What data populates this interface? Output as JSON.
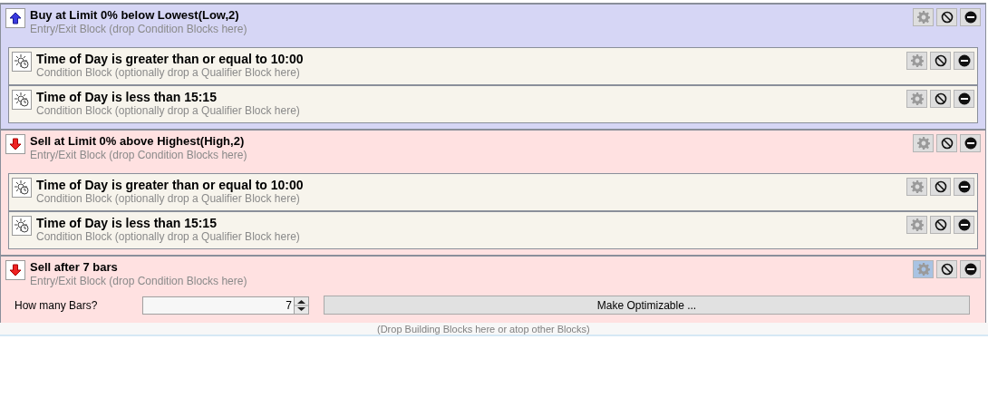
{
  "blocks": [
    {
      "kind": "buy",
      "title": "Buy at Limit 0% below Lowest(Low,2)",
      "subtitle": "Entry/Exit Block (drop Condition Blocks here)",
      "gear_highlighted": false,
      "conditions": [
        {
          "title": "Time of Day is greater than or equal to 10:00",
          "subtitle": "Condition Block (optionally drop a Qualifier Block here)"
        },
        {
          "title": "Time of Day is less than 15:15",
          "subtitle": "Condition Block (optionally drop a Qualifier Block here)"
        }
      ]
    },
    {
      "kind": "sell",
      "title": "Sell at Limit 0% above Highest(High,2)",
      "subtitle": "Entry/Exit Block (drop Condition Blocks here)",
      "gear_highlighted": false,
      "conditions": [
        {
          "title": "Time of Day is greater than or equal to 10:00",
          "subtitle": "Condition Block (optionally drop a Qualifier Block here)"
        },
        {
          "title": "Time of Day is less than 15:15",
          "subtitle": "Condition Block (optionally drop a Qualifier Block here)"
        }
      ]
    },
    {
      "kind": "sell",
      "title": "Sell after 7 bars",
      "subtitle": "Entry/Exit Block (drop Condition Blocks here)",
      "gear_highlighted": true,
      "parameter": {
        "label": "How many Bars?",
        "value": "7",
        "button": "Make Optimizable ..."
      }
    }
  ],
  "drop_hint": "(Drop Building Blocks here or atop other Blocks)"
}
